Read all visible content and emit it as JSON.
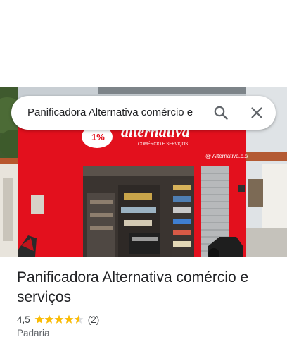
{
  "search": {
    "query": "Panificadora Alternativa comércio e"
  },
  "photo": {
    "sign_brand": "alternativa",
    "sign_sub": "COMÉRCIO E SERVIÇOS",
    "sign_instagram": "@ Alternativa.c.s",
    "sign_logo_mark": "1%"
  },
  "place": {
    "title": "Panificadora Alternativa comércio e serviços",
    "rating": "4,5",
    "rating_stars": 4.5,
    "review_count": "(2)",
    "category": "Padaria"
  },
  "colors": {
    "storefront_red": "#e3101d",
    "star_gold": "#fbbc04",
    "text_primary": "#202124",
    "text_secondary": "#5f6368"
  },
  "icons": [
    "search-icon",
    "close-icon",
    "star-icon",
    "instagram-icon"
  ]
}
